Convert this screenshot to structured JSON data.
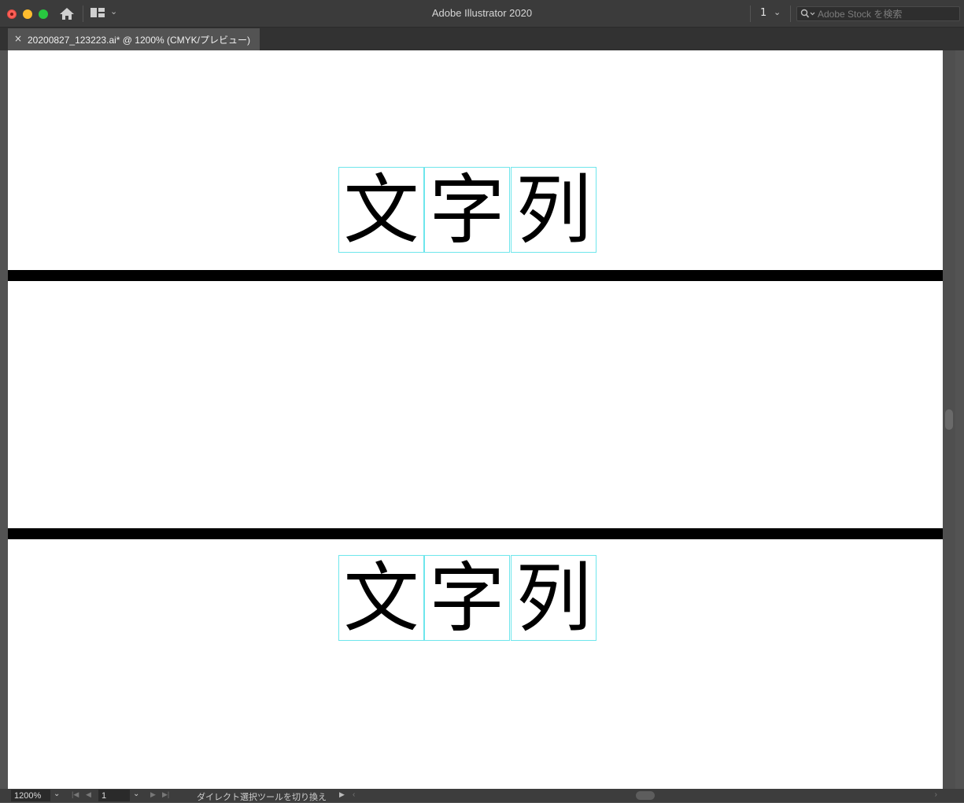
{
  "app": {
    "title": "Adobe Illustrator 2020"
  },
  "toolbar": {
    "page_number": "1",
    "search_placeholder": "Adobe Stock を検索"
  },
  "document_tab": {
    "close": "×",
    "label": "20200827_123223.ai* @ 1200% (CMYK/プレビュー)"
  },
  "artboard": {
    "text_groups": [
      {
        "glyphs": [
          "文",
          "字",
          "列"
        ]
      },
      {
        "glyphs": [
          "文",
          "字",
          "列"
        ]
      }
    ]
  },
  "status_bar": {
    "zoom": "1200%",
    "artboard_number": "1",
    "status_text": "ダイレクト選択ツールを切り換え"
  },
  "icons": {
    "close": "close-icon",
    "minimize": "minimize-icon",
    "zoom": "zoom-icon",
    "home": "home-icon",
    "workspace": "workspace-layout-icon",
    "search": "search-icon"
  },
  "colors": {
    "guide_cyan": "#6ee6ec",
    "chrome_dark": "#3b3b3b",
    "canvas": "#ffffff"
  }
}
